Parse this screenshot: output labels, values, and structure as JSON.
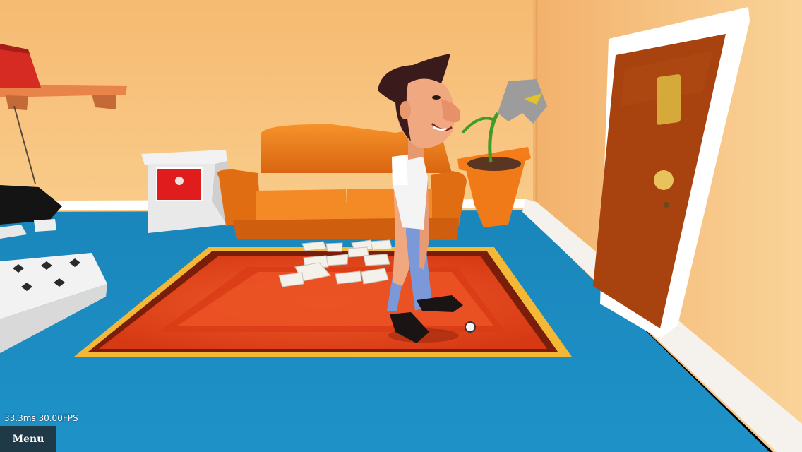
{
  "hud": {
    "fps_readout": "33.3ms 30.00FPS",
    "menu_label": "Menu"
  },
  "colors": {
    "wall": "#f7c076",
    "floor": "#1d8fc4",
    "rug": "#e0431a",
    "rug_fringe": "#f2b836",
    "door": "#a3400f",
    "couch": "#f07d1a",
    "menu_bg": "#1f3a46"
  },
  "scene_objects": [
    "wall-shelf",
    "red-book",
    "white-nightstand",
    "orange-couch",
    "potted-plant",
    "wooden-door",
    "door-knob",
    "red-rug",
    "scattered-papers",
    "character",
    "bed",
    "black-box",
    "small-ball"
  ]
}
